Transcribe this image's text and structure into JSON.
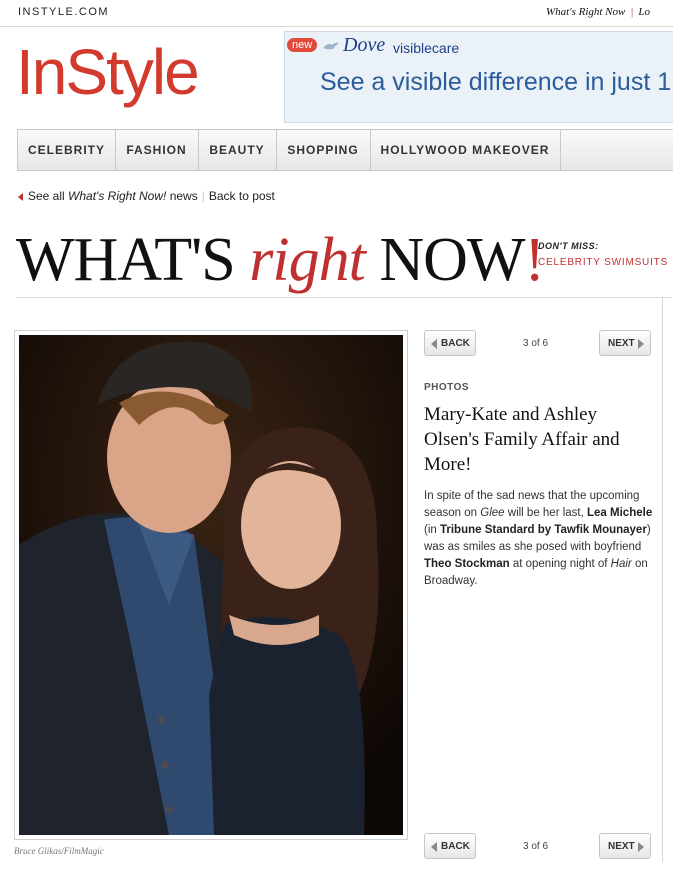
{
  "topbar": {
    "site_name": "INSTYLE.COM",
    "link1": "What's Right Now",
    "link2": "Lo"
  },
  "logo": "InStyle",
  "ad": {
    "badge": "new",
    "brand": "Dove",
    "brand_sub": "visiblecare",
    "headline": "See a visible difference in just 1"
  },
  "nav": {
    "items": [
      "CELEBRITY",
      "FASHION",
      "BEAUTY",
      "SHOPPING",
      "HOLLYWOOD MAKEOVER"
    ]
  },
  "breadcrumb": {
    "see_all_prefix": "See all ",
    "see_all_italic": "What's Right Now!",
    "see_all_suffix": " news",
    "back": "Back to post"
  },
  "hero": {
    "part1": "WHAT'S ",
    "part2": "right",
    "part3": " NOW",
    "part4": "!",
    "dont_miss_label": "DON'T MISS:",
    "dont_miss_link": "CELEBRITY SWIMSUITS"
  },
  "pager": {
    "back": "BACK",
    "next": "NEXT",
    "count": "3 of 6"
  },
  "photo": {
    "credit": "Bruce Glikas/FilmMagic"
  },
  "article": {
    "section": "PHOTOS",
    "title": "Mary-Kate and Ashley Olsen's Family Affair and More!",
    "body": {
      "t1": "In spite of the sad news that the upcoming season on ",
      "glee": "Glee",
      "t2": " will be her last, ",
      "lea": "Lea Michele",
      "t3": " (in ",
      "designer": "Tribune Standard by Tawfik Mounayer",
      "t4": ") was as smiles as she posed with boyfriend ",
      "theo": "Theo Stockman",
      "t5": " at opening night of ",
      "hair": "Hair",
      "t6": " on Broadway."
    }
  },
  "colors": {
    "brand_red": "#d23a2e",
    "accent_red": "#c03030",
    "ad_blue": "#2b5c9c"
  }
}
